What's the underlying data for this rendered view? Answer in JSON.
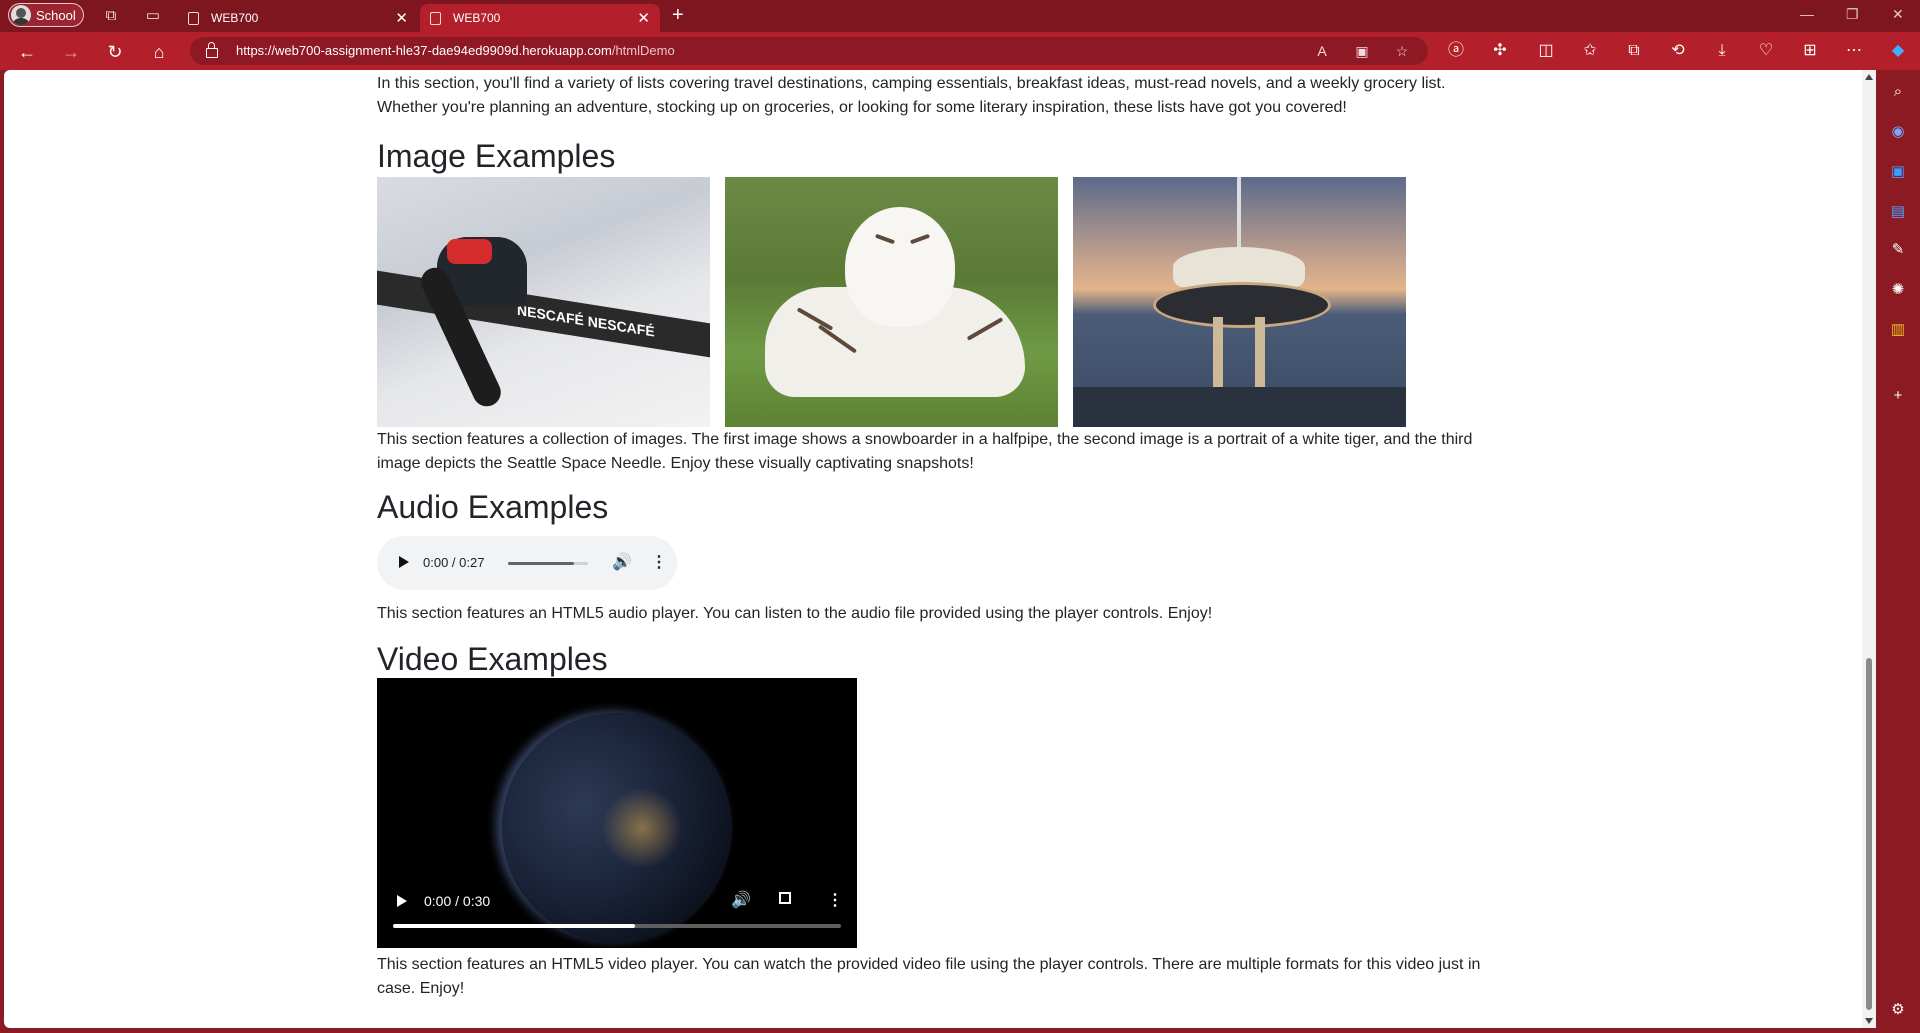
{
  "browser": {
    "profile_label": "School",
    "tabs": [
      {
        "title": "WEB700",
        "active": false
      },
      {
        "title": "WEB700",
        "active": true
      }
    ],
    "url_host": "https://web700-assignment-hle37-dae94ed9909d.herokuapp.com",
    "url_path": "/htmlDemo",
    "accent_color": "#b3202c"
  },
  "page": {
    "lists_intro": "In this section, you'll find a variety of lists covering travel destinations, camping essentials, breakfast ideas, must-read novels, and a weekly grocery list. Whether you're planning an adventure, stocking up on groceries, or looking for some literary inspiration, these lists have got you covered!",
    "images": {
      "heading": "Image Examples",
      "banner_text": "NESCAFÉ NESCAFÉ",
      "items": [
        "snowboarder-in-halfpipe",
        "white-tiger-portrait",
        "seattle-space-needle"
      ],
      "description": "This section features a collection of images. The first image shows a snowboarder in a halfpipe, the second image is a portrait of a white tiger, and the third image depicts the Seattle Space Needle. Enjoy these visually captivating snapshots!"
    },
    "audio": {
      "heading": "Audio Examples",
      "time": "0:00 / 0:27",
      "description": "This section features an HTML5 audio player. You can listen to the audio file provided using the player controls. Enjoy!"
    },
    "video": {
      "heading": "Video Examples",
      "time": "0:00 / 0:30",
      "description": "This section features an HTML5 video player. You can watch the provided video file using the player controls. There are multiple formats for this video just in case. Enjoy!"
    }
  }
}
